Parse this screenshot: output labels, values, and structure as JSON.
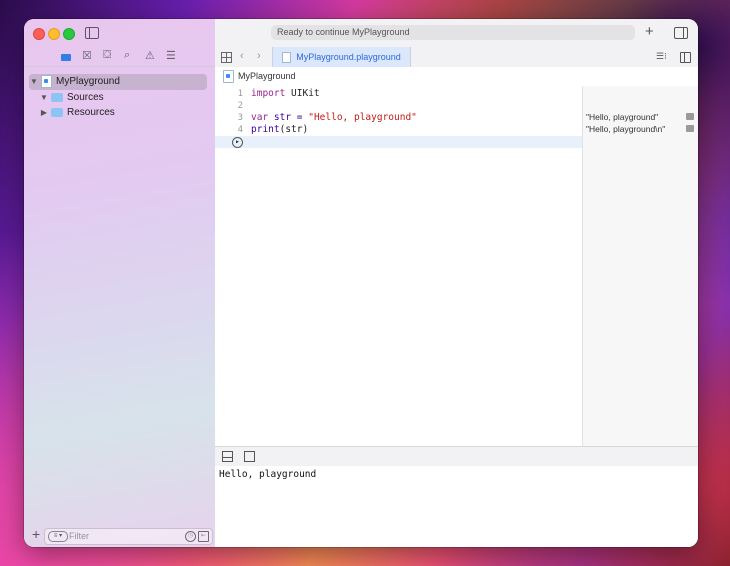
{
  "window": {
    "status_text": "Ready to continue MyPlayground"
  },
  "sidebar": {
    "tree": [
      {
        "label": "MyPlayground",
        "selected": true
      },
      {
        "label": "Sources"
      },
      {
        "label": "Resources"
      }
    ],
    "filter_placeholder": "Filter"
  },
  "editor": {
    "tab_label": "MyPlayground.playground",
    "breadcrumb": "MyPlayground",
    "lines": [
      {
        "num": "1",
        "keyword": "import",
        "rest": " UIKit"
      },
      {
        "num": "2"
      },
      {
        "num": "3",
        "keyword": "var",
        "name": " str = ",
        "string": "\"Hello, playground\""
      },
      {
        "num": "4",
        "fn": "print",
        "args": "(str)"
      }
    ],
    "results": [
      "\"Hello, playground\"",
      "\"Hello, playground\\n\""
    ]
  },
  "console": {
    "output": "Hello, playground"
  },
  "icons": {
    "toolbar": [
      "sidebar-toggle-icon",
      "add-icon",
      "inspector-toggle-icon"
    ],
    "navigator": [
      "folder-icon",
      "source-control-icon",
      "symbol-icon",
      "find-icon",
      "issue-icon",
      "report-icon"
    ]
  },
  "colors": {
    "keyword": "#9b2393",
    "string": "#c41a16",
    "function": "#3900a0",
    "tab_accent": "#2f6ad9"
  }
}
